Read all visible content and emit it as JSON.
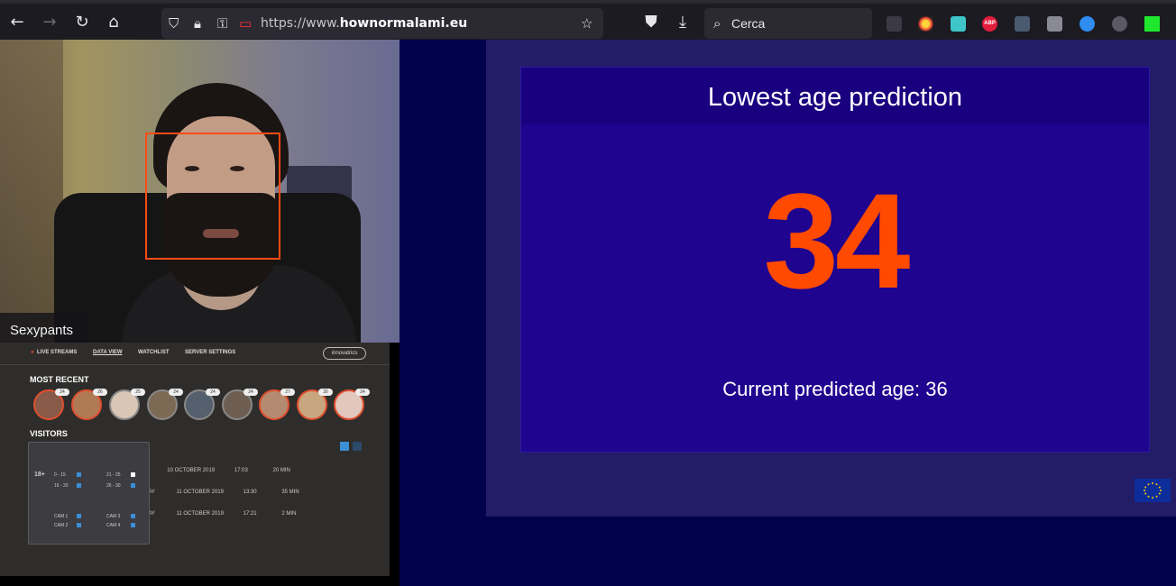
{
  "browser": {
    "url_prefix": "https://www.",
    "url_domain": "hownormalami.eu",
    "search_placeholder": "Cerca",
    "extensions": [
      {
        "name": "abp",
        "label": "ABP",
        "color": "#e11d3c"
      },
      {
        "name": "green-square",
        "label": "",
        "color": "#1ee82e"
      }
    ]
  },
  "webcam": {
    "name_tag": "Sexypants"
  },
  "dashboard": {
    "nav": [
      "LIVE STREAMS",
      "DATA VIEW",
      "WATCHLIST",
      "SERVER SETTINGS"
    ],
    "logo": "innovatrics",
    "most_recent_title": "MOST RECENT",
    "visitors_title": "VISITORS",
    "avatar_badges": [
      "24",
      "26",
      "25",
      "24",
      "24",
      "24",
      "27",
      "30",
      "24"
    ],
    "visitor_rows": [
      {
        "prefix": "|",
        "date": "10 OCTOBER 2019",
        "time": "17:03",
        "duration": "20 MIN"
      },
      {
        "prefix": "DAY",
        "date": "11 OCTOBER 2019",
        "time": "13:30",
        "duration": "35 MIN"
      },
      {
        "prefix": "DAY",
        "date": "11 OCTOBER 2019",
        "time": "17:21",
        "duration": "2 MIN"
      }
    ],
    "filter": {
      "age_label": "18+",
      "ranges": [
        "0 - 15",
        "16 - 20",
        "21 - 25",
        "26 - 30"
      ],
      "cams": [
        "CAM 1",
        "CAM 2",
        "CAM 3",
        "CAM 4"
      ]
    }
  },
  "result": {
    "title": "Lowest age prediction",
    "lowest_age": "34",
    "current_label": "Current predicted age: 36"
  }
}
